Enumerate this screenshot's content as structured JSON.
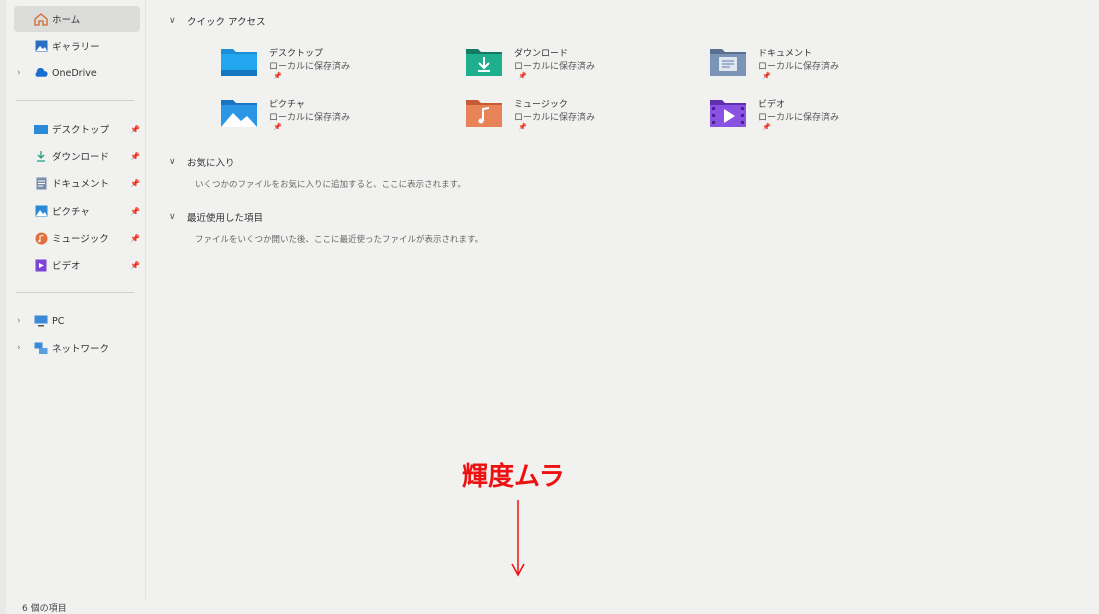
{
  "sidebar": {
    "home": "ホーム",
    "gallery": "ギャラリー",
    "onedrive": "OneDrive",
    "pinned": [
      {
        "label": "デスクトップ",
        "icon": "desktop-icon"
      },
      {
        "label": "ダウンロード",
        "icon": "download-icon"
      },
      {
        "label": "ドキュメント",
        "icon": "document-icon"
      },
      {
        "label": "ピクチャ",
        "icon": "picture-icon"
      },
      {
        "label": "ミュージック",
        "icon": "music-icon"
      },
      {
        "label": "ビデオ",
        "icon": "video-icon"
      }
    ],
    "pc": "PC",
    "network": "ネットワーク"
  },
  "main": {
    "quick_access": {
      "title": "クイック アクセス",
      "tiles": [
        {
          "name": "デスクトップ",
          "sub": "ローカルに保存済み",
          "color": "#1c8fd8"
        },
        {
          "name": "ダウンロード",
          "sub": "ローカルに保存済み",
          "color": "#1f9f82"
        },
        {
          "name": "ドキュメント",
          "sub": "ローカルに保存済み",
          "color": "#6b86a8"
        },
        {
          "name": "ピクチャ",
          "sub": "ローカルに保存済み",
          "color": "#2b8ad6"
        },
        {
          "name": "ミュージック",
          "sub": "ローカルに保存済み",
          "color": "#e07a4a"
        },
        {
          "name": "ビデオ",
          "sub": "ローカルに保存済み",
          "color": "#7c45d6"
        }
      ]
    },
    "favorites": {
      "title": "お気に入り",
      "hint": "いくつかのファイルをお気に入りに追加すると、ここに表示されます。"
    },
    "recent": {
      "title": "最近使用した項目",
      "hint": "ファイルをいくつか開いた後、ここに最近使ったファイルが表示されます。"
    }
  },
  "status_bar": {
    "count": "6 個の項目"
  },
  "annotation": {
    "text": "輝度ムラ",
    "color": "#ee1111"
  }
}
